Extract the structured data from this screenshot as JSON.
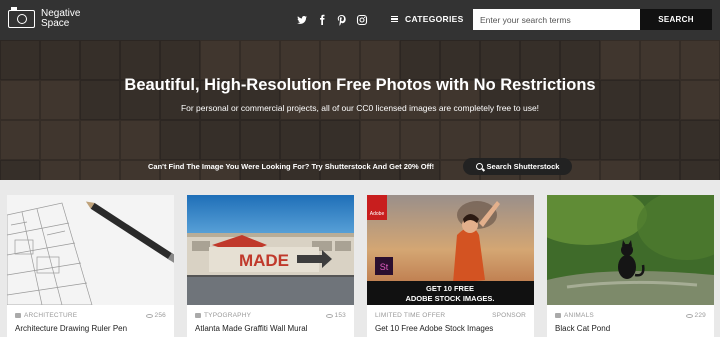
{
  "nav": {
    "logo_line1": "Negative",
    "logo_line2": "Space",
    "social": [
      "twitter-icon",
      "facebook-icon",
      "pinterest-icon",
      "instagram-icon"
    ],
    "categories_label": "CATEGORIES",
    "search_placeholder": "Enter your search terms",
    "search_button": "SEARCH"
  },
  "hero": {
    "title": "Beautiful, High-Resolution Free Photos with No Restrictions",
    "subtitle": "For personal or commercial projects, all of our CC0 licensed images are completely free to use!",
    "promo_text": "Can't Find The Image You Were Looking For? Try Shutterstock And Get 20% Off!",
    "promo_button": "Search Shutterstock"
  },
  "cards": [
    {
      "category": "ARCHITECTURE",
      "views": "256",
      "title": "Architecture Drawing Ruler Pen"
    },
    {
      "category": "TYPOGRAPHY",
      "views": "153",
      "title": "Atlanta Made Graffiti Wall Mural",
      "image_text": "MADE"
    },
    {
      "category": "LIMITED TIME OFFER",
      "views": "SPONSOR",
      "title": "Get 10 Free Adobe Stock Images",
      "ad_line1": "GET 10 FREE",
      "ad_line2": "ADOBE STOCK IMAGES.",
      "ad_badge": "St",
      "ad_brand": "Adobe"
    },
    {
      "category": "ANIMALS",
      "views": "229",
      "title": "Black Cat Pond"
    }
  ],
  "colors": {
    "nav_bg": "#333333",
    "page_bg": "#e9e9e9",
    "button_dark": "#111111"
  }
}
